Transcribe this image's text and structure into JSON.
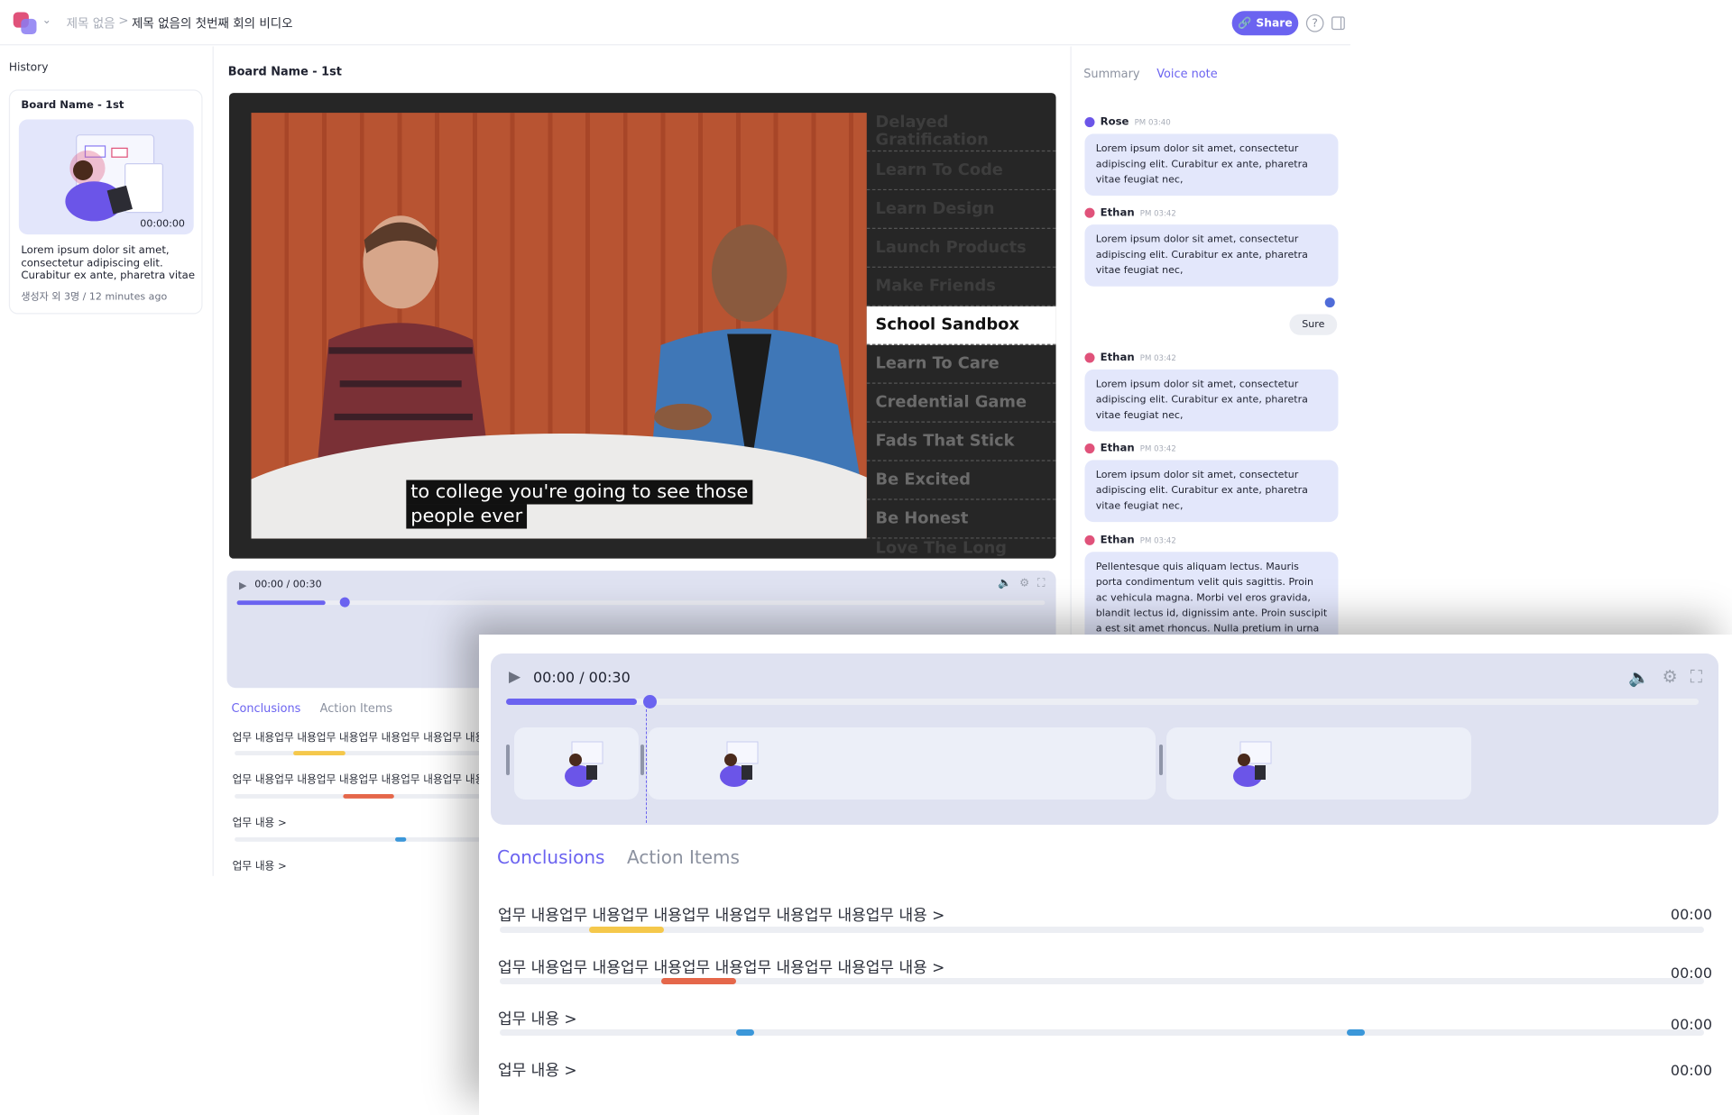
{
  "header": {
    "crumb_root": "제목 없음",
    "crumb_separator": ">",
    "crumb_current": "제목 없음의 첫번째 회의 비디오",
    "share_label": "Share",
    "help_symbol": "?",
    "icons": [
      "logo-icon",
      "chevron-down-icon",
      "link-icon",
      "help-icon",
      "sidebar-toggle-icon"
    ]
  },
  "sidebar": {
    "title": "History",
    "card": {
      "title": "Board Name - 1st",
      "duration": "00:00:00",
      "description": "Lorem ipsum dolor sit amet, consectetur adipiscing elit. Curabitur ex ante, pharetra vitae",
      "meta": "생성자 외 3명 / 12 minutes ago"
    }
  },
  "main": {
    "title": "Board Name - 1st",
    "caption_line1": "to college you're going to see those",
    "caption_line2": "people ever",
    "chapters": [
      "Delayed Gratification",
      "Learn To Code",
      "Learn Design",
      "Launch Products",
      "Make Friends",
      "School Sandbox",
      "Learn To Care",
      "Credential Game",
      "Fads That Stick",
      "Be Excited",
      "Be Honest",
      "Love The Long Game"
    ],
    "active_chapter": "School Sandbox"
  },
  "player": {
    "time": "00:00 / 00:30",
    "progress": 0.11,
    "icons": [
      "play-icon",
      "volume-icon",
      "settings-icon",
      "fullscreen-icon"
    ]
  },
  "tabs": {
    "conclusions": "Conclusions",
    "action_items": "Action Items"
  },
  "conclusions": [
    {
      "text": "업무 내용업무 내용업무 내용업무 내용업무 내용업무 내용업무 내용 >",
      "time": "00:00",
      "color": "#f5c84b",
      "marks": [
        [
          0.074,
          0.136
        ]
      ]
    },
    {
      "text": "업무 내용업무 내용업무 내용업무 내용업무 내용업무 내용업무 내용 >",
      "time": "00:00",
      "color": "#e5674a",
      "marks": [
        [
          0.134,
          0.196
        ]
      ]
    },
    {
      "text": "업무 내용 >",
      "time": "00:00",
      "color": "#3b97d9",
      "marks": [
        [
          0.196,
          0.211
        ],
        [
          0.703,
          0.718
        ]
      ]
    },
    {
      "text": "업무 내용 >",
      "time": "00:00",
      "color": "#3b97d9",
      "marks": []
    }
  ],
  "right_panel": {
    "tab_summary": "Summary",
    "tab_voice": "Voice note",
    "messages": [
      {
        "name": "Rose",
        "time": "PM 03:40",
        "text": "Lorem ipsum dolor sit amet, consectetur adipiscing elit. Curabitur ex ante, pharetra vitae feugiat nec,"
      },
      {
        "name": "Ethan",
        "time": "PM 03:42",
        "text": "Lorem ipsum dolor sit amet, consectetur adipiscing elit. Curabitur ex ante, pharetra vitae feugiat nec,"
      },
      {
        "name": "Ethan",
        "time": "PM 03:42",
        "text": "Lorem ipsum dolor sit amet, consectetur adipiscing elit. Curabitur ex ante, pharetra vitae feugiat nec,"
      },
      {
        "name": "Ethan",
        "time": "PM 03:42",
        "text": "Lorem ipsum dolor sit amet, consectetur adipiscing elit. Curabitur ex ante, pharetra vitae feugiat nec,"
      },
      {
        "name": "Ethan",
        "time": "PM 03:42",
        "text": "Pellentesque quis aliquam lectus. Mauris porta condimentum velit quis sagittis. Proin ac vehicula magna. Morbi vel eros gravida, blandit lectus id, dignissim ante. Proin suscipit a est sit amet rhoncus. Nulla pretium in urna nec"
      }
    ],
    "reply": "Sure"
  },
  "colors": {
    "accent": "#6b63f0",
    "bubble": "#e3e7fb",
    "player_bg": "#dfe2f1"
  }
}
